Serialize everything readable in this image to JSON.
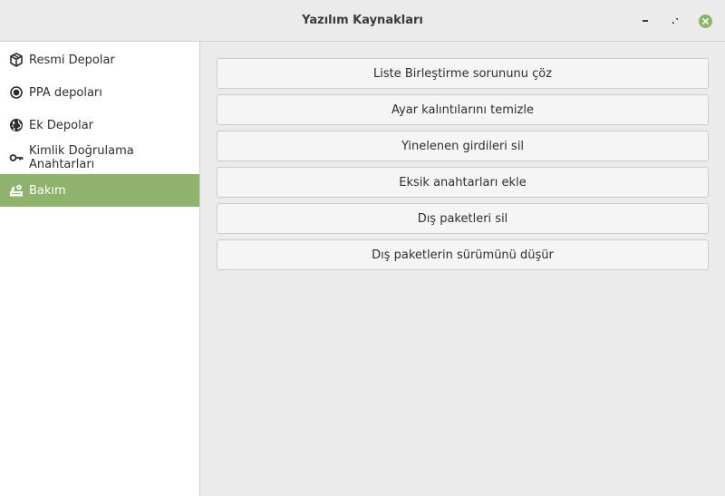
{
  "window": {
    "title": "Yazılım Kaynakları"
  },
  "sidebar": {
    "items": [
      {
        "label": "Resmi Depolar",
        "icon": "package-icon"
      },
      {
        "label": "PPA depoları",
        "icon": "ppa-icon"
      },
      {
        "label": "Ek Depolar",
        "icon": "globe-icon"
      },
      {
        "label": "Kimlik Doğrulama Anahtarları",
        "icon": "key-icon"
      },
      {
        "label": "Bakım",
        "icon": "maintenance-icon",
        "selected": true
      }
    ]
  },
  "main": {
    "buttons": [
      {
        "label": "Liste Birleştirme sorununu çöz"
      },
      {
        "label": "Ayar kalıntılarını temizle"
      },
      {
        "label": "Yinelenen girdileri sil"
      },
      {
        "label": "Eksik anahtarları ekle"
      },
      {
        "label": "Dış paketleri sil"
      },
      {
        "label": "Dış paketlerin sürümünü düşür"
      }
    ]
  },
  "colors": {
    "accent": "#8fb26d",
    "close_button": "#8cb568",
    "sidebar_bg": "#ffffff",
    "window_bg": "#ebebeb"
  }
}
